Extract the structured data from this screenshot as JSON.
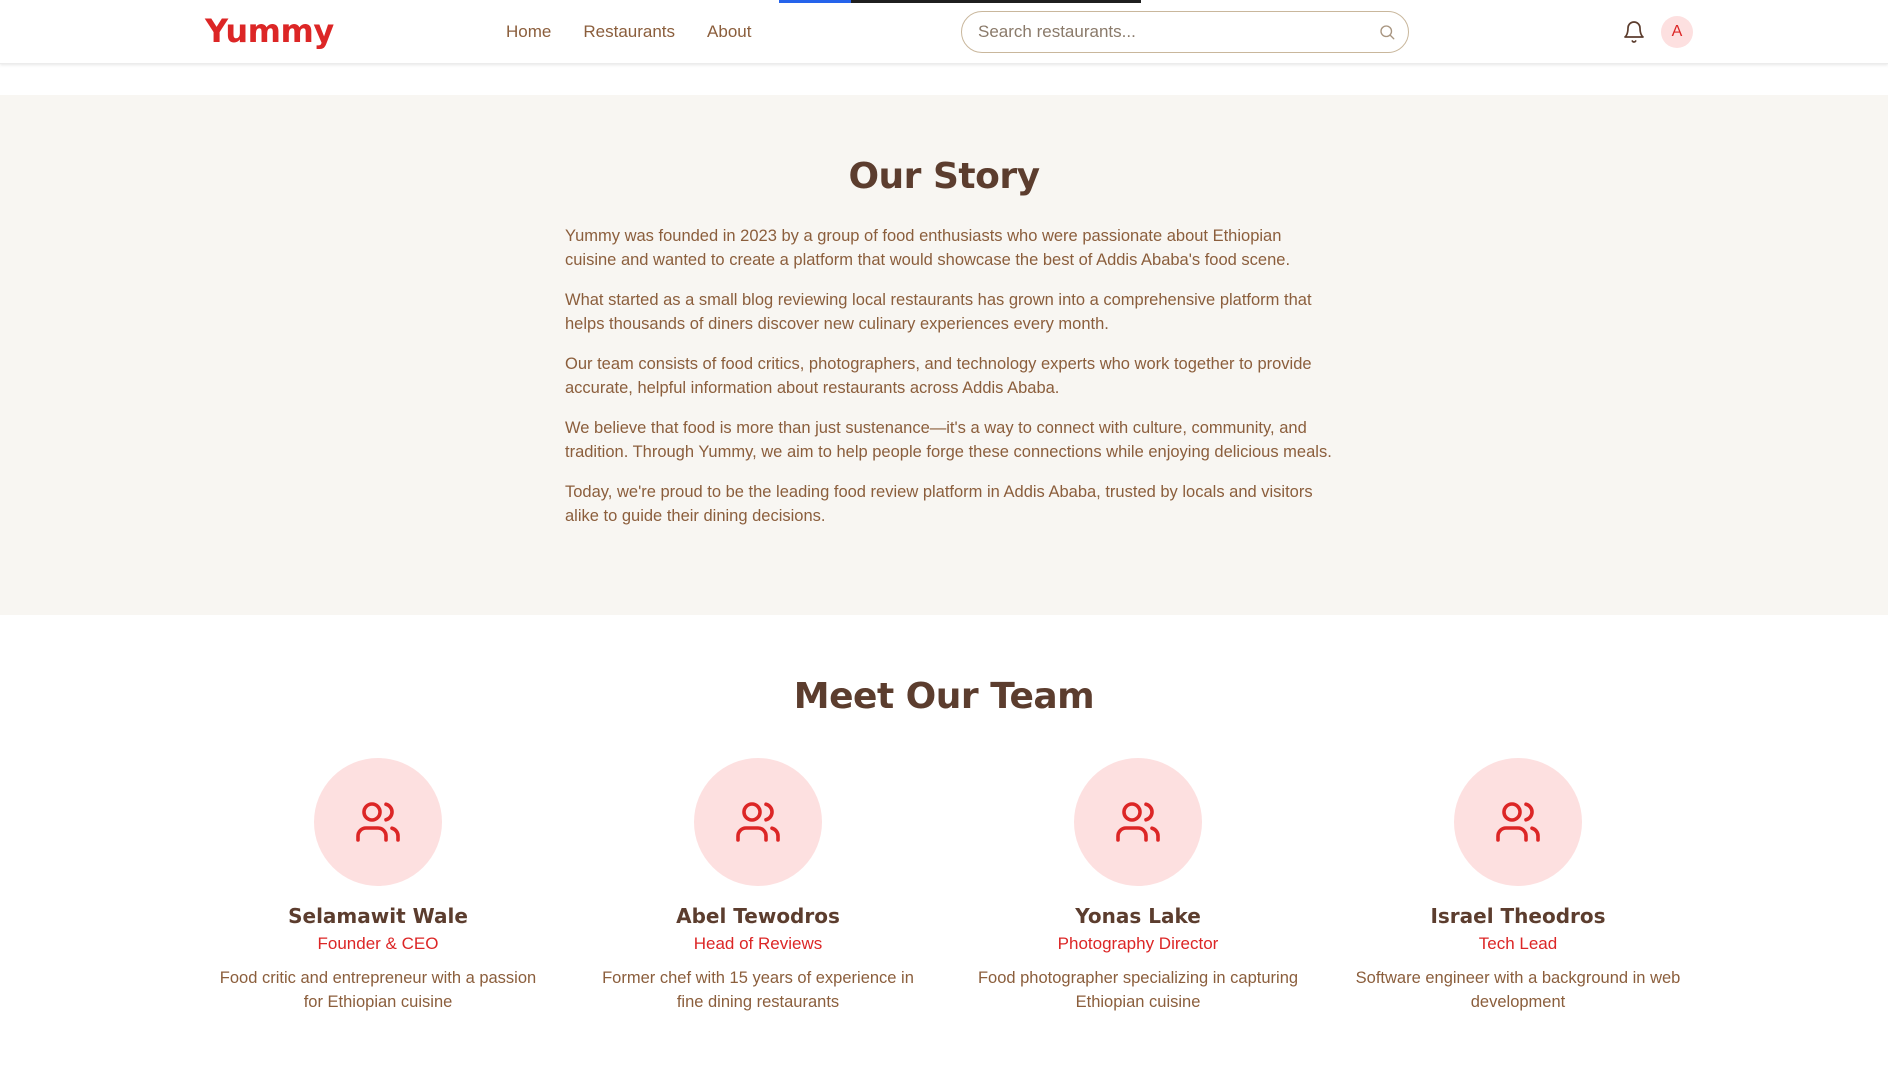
{
  "header": {
    "logo": "Yummy",
    "nav": [
      "Home",
      "Restaurants",
      "About"
    ],
    "search_placeholder": "Search restaurants...",
    "avatar_initial": "A",
    "loading_progress": 0.2
  },
  "story": {
    "title": "Our Story",
    "paragraphs": [
      "Yummy was founded in 2023 by a group of food enthusiasts who were passionate about Ethiopian cuisine and wanted to create a platform that would showcase the best of Addis Ababa's food scene.",
      "What started as a small blog reviewing local restaurants has grown into a comprehensive platform that helps thousands of diners discover new culinary experiences every month.",
      "Our team consists of food critics, photographers, and technology experts who work together to provide accurate, helpful information about restaurants across Addis Ababa.",
      "We believe that food is more than just sustenance—it's a way to connect with culture, community, and tradition. Through Yummy, we aim to help people forge these connections while enjoying delicious meals.",
      "Today, we're proud to be the leading food review platform in Addis Ababa, trusted by locals and visitors alike to guide their dining decisions."
    ]
  },
  "team": {
    "title": "Meet Our Team",
    "members": [
      {
        "name": "Selamawit Wale",
        "role": "Founder & CEO",
        "bio": "Food critic and entrepreneur with a passion for Ethiopian cuisine",
        "icon": "users-icon"
      },
      {
        "name": "Abel Tewodros",
        "role": "Head of Reviews",
        "bio": "Former chef with 15 years of experience in fine dining restaurants",
        "icon": "users-icon"
      },
      {
        "name": "Yonas Lake",
        "role": "Photography Director",
        "bio": "Food photographer specializing in capturing Ethiopian cuisine",
        "icon": "users-icon"
      },
      {
        "name": "Israel Theodros",
        "role": "Tech Lead",
        "bio": "Software engineer with a background in web development",
        "icon": "users-icon"
      }
    ]
  },
  "colors": {
    "brand": "#dc2626",
    "heading": "#5c3d2e",
    "body_text": "#8b5e3c",
    "story_bg": "#f8f6f2",
    "avatar_bg": "#fde0e0"
  }
}
